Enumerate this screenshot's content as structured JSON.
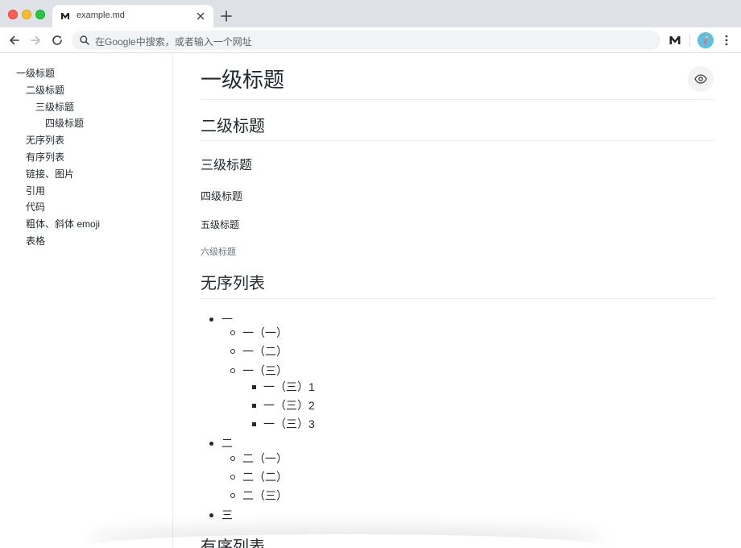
{
  "browser": {
    "tab_title": "example.md",
    "omnibox_placeholder": "在Google中搜索，或者输入一个网址"
  },
  "toc": {
    "items": [
      {
        "label": "一级标题",
        "level": 1
      },
      {
        "label": "二级标题",
        "level": 2
      },
      {
        "label": "三级标题",
        "level": 3
      },
      {
        "label": "四级标题",
        "level": 4
      },
      {
        "label": "无序列表",
        "level": 2
      },
      {
        "label": "有序列表",
        "level": 2
      },
      {
        "label": "链接、图片",
        "level": 2
      },
      {
        "label": "引用",
        "level": 2
      },
      {
        "label": "代码",
        "level": 2
      },
      {
        "label": "粗体、斜体 emoji",
        "level": 2
      },
      {
        "label": "表格",
        "level": 2
      }
    ]
  },
  "doc": {
    "h1": "一级标题",
    "h2": "二级标题",
    "h3": "三级标题",
    "h4": "四级标题",
    "h5": "五级标题",
    "h6": "六级标题",
    "unordered_heading": "无序列表",
    "unordered_list": [
      {
        "text": "一",
        "children": [
          {
            "text": "一（一）"
          },
          {
            "text": "一（二）"
          },
          {
            "text": "一（三）",
            "children": [
              {
                "text": "一（三）1"
              },
              {
                "text": "一（三）2"
              },
              {
                "text": "一（三）3"
              }
            ]
          }
        ]
      },
      {
        "text": "二",
        "children": [
          {
            "text": "二（一）"
          },
          {
            "text": "二（二）"
          },
          {
            "text": "二（三）"
          }
        ]
      },
      {
        "text": "三"
      }
    ],
    "ordered_heading": "有序列表"
  },
  "colors": {
    "tabstrip": "#dee1e6",
    "text": "#24292e",
    "muted": "#6a737d",
    "rule": "#eaecef"
  }
}
